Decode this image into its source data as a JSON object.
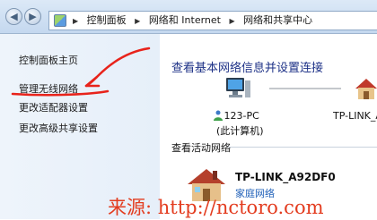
{
  "address_bar": {
    "breadcrumbs": [
      "控制面板",
      "网络和 Internet",
      "网络和共享中心"
    ]
  },
  "sidebar": {
    "items": [
      {
        "label": "控制面板主页"
      },
      {
        "label": "管理无线网络"
      },
      {
        "label": "更改适配器设置"
      },
      {
        "label": "更改高级共享设置"
      }
    ]
  },
  "main": {
    "title": "查看基本网络信息并设置连接",
    "computer": {
      "name": "123-PC",
      "subtitle": "(此计算机)"
    },
    "network_map_label": "TP-LINK_A",
    "active_section": "查看活动网络",
    "active_network": {
      "name": "TP-LINK_A92DF0",
      "type": "家庭网络"
    }
  },
  "watermark": "来源: http://nctoro.com",
  "colors": {
    "title": "#1e3287",
    "annotation": "#e8231b",
    "watermark": "#e33c1f",
    "link": "#1e5fb8"
  },
  "icons": [
    "back-icon",
    "forward-icon",
    "control-panel-icon",
    "computer-icon",
    "house-icon",
    "user-icon"
  ]
}
